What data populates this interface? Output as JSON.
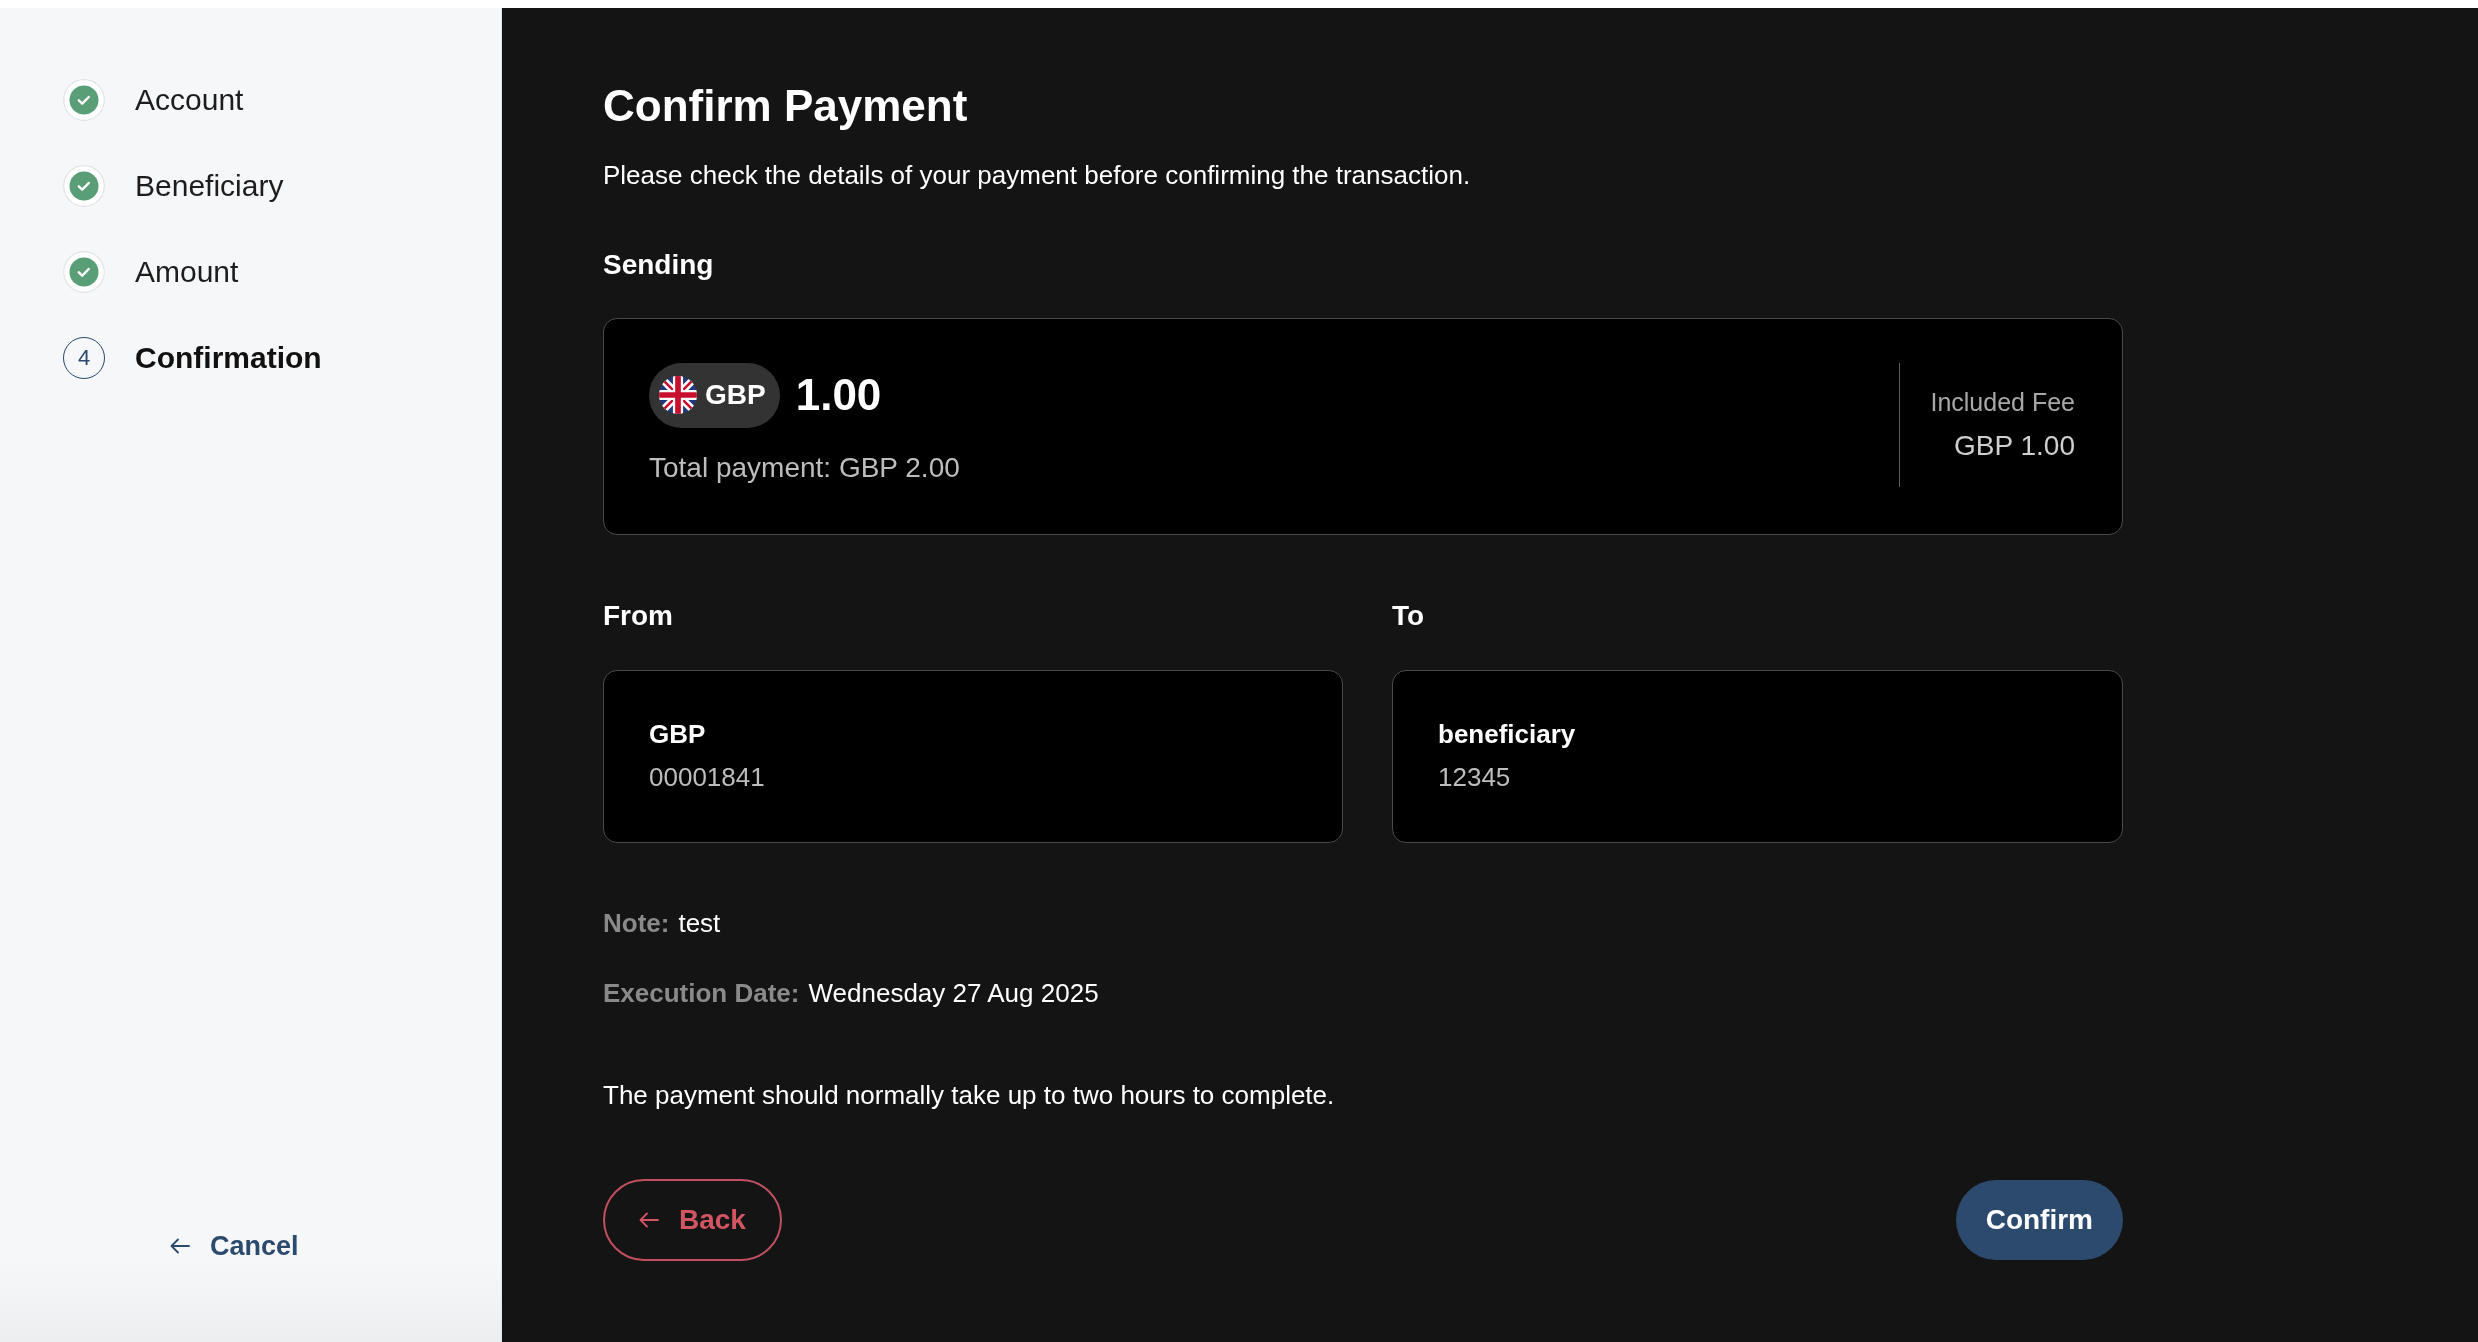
{
  "sidebar": {
    "steps": [
      {
        "label": "Account",
        "completed": true,
        "selected": false
      },
      {
        "label": "Beneficiary",
        "completed": true,
        "selected": false
      },
      {
        "label": "Amount",
        "completed": true,
        "selected": false
      },
      {
        "label": "Confirmation",
        "number": "4",
        "completed": false,
        "selected": true
      }
    ],
    "cancel": "Cancel"
  },
  "page": {
    "title": "Confirm Payment",
    "description": "Please check the details of your payment before confirming the transaction."
  },
  "sending": {
    "heading": "Sending",
    "currency": "GBP",
    "amount": "1.00",
    "total": "Total payment: GBP 2.00",
    "fee_label": "Included Fee",
    "fee_value": "GBP 1.00"
  },
  "from": {
    "heading": "From",
    "name": "GBP",
    "account": "00001841"
  },
  "to": {
    "heading": "To",
    "name": "beneficiary",
    "account": "12345"
  },
  "details": [
    {
      "label": "Note:",
      "value": "test"
    },
    {
      "label": "Execution Date:",
      "value": "Wednesday 27 Aug 2025"
    }
  ],
  "notice": "The payment should normally take up to two hours to complete.",
  "buttons": {
    "back": "Back",
    "confirm": "Confirm"
  }
}
